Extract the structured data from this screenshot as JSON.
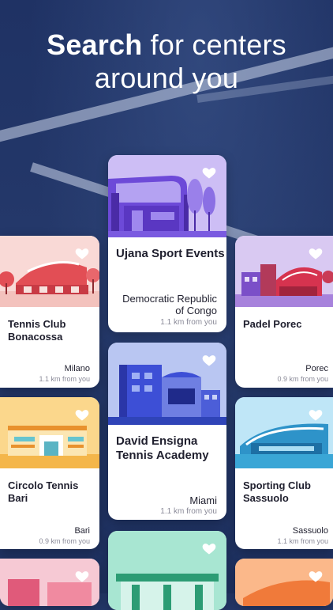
{
  "headline": {
    "strong": "Search",
    "rest1": " for centers",
    "line2": "around you"
  },
  "cards": {
    "ujana": {
      "title": "Ujana Sport Events",
      "place": "Democratic Republic of Congo",
      "distance": "1.1 km from you"
    },
    "bonacossa": {
      "title": "Tennis Club Bonacossa",
      "place": "Milano",
      "distance": "1.1 km from you"
    },
    "porec": {
      "title": "Padel Porec",
      "place": "Porec",
      "distance": "0.9 km from you"
    },
    "ensigna": {
      "title": "David Ensigna Tennis Academy",
      "place": "Miami",
      "distance": "1.1 km from you"
    },
    "bari": {
      "title": "Circolo Tennis Bari",
      "place": "Bari",
      "distance": "0.9 km from you"
    },
    "sassuolo": {
      "title": "Sporting Club Sassuolo",
      "place": "Sassuolo",
      "distance": "1.1 km from you"
    }
  },
  "colors": {
    "background": "#24386a",
    "card": "#ffffff",
    "heart": "#ffffff"
  },
  "icons": {
    "favorite": "heart-icon"
  }
}
